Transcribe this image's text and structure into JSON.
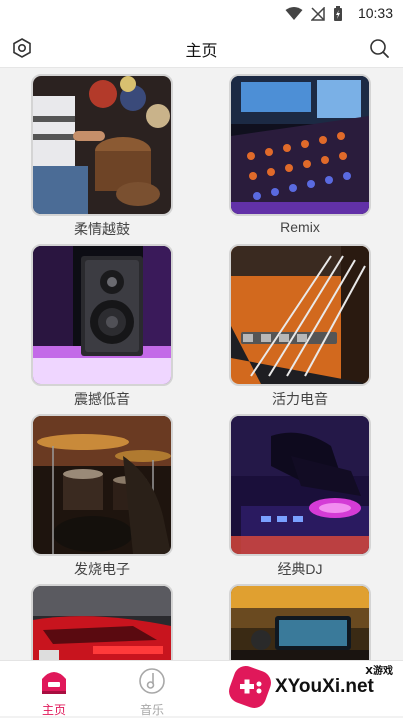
{
  "status_bar": {
    "time": "10:33"
  },
  "app_bar": {
    "title": "主页"
  },
  "cards": [
    {
      "label": "柔情越鼓"
    },
    {
      "label": "Remix"
    },
    {
      "label": "震撼低音"
    },
    {
      "label": "活力电音"
    },
    {
      "label": "发烧电子"
    },
    {
      "label": "经典DJ"
    },
    {
      "label": ""
    },
    {
      "label": ""
    }
  ],
  "bottom_nav": {
    "items": [
      {
        "label": "主页",
        "icon": "home-icon",
        "active": true
      },
      {
        "label": "音乐",
        "icon": "music-icon",
        "active": false
      }
    ],
    "active_color": "#e0185a",
    "inactive_color": "#a8a8a8"
  },
  "watermark": {
    "brand": "XYouXi.net",
    "tag": "X游戏"
  },
  "colors": {
    "accent": "#e0185a"
  }
}
